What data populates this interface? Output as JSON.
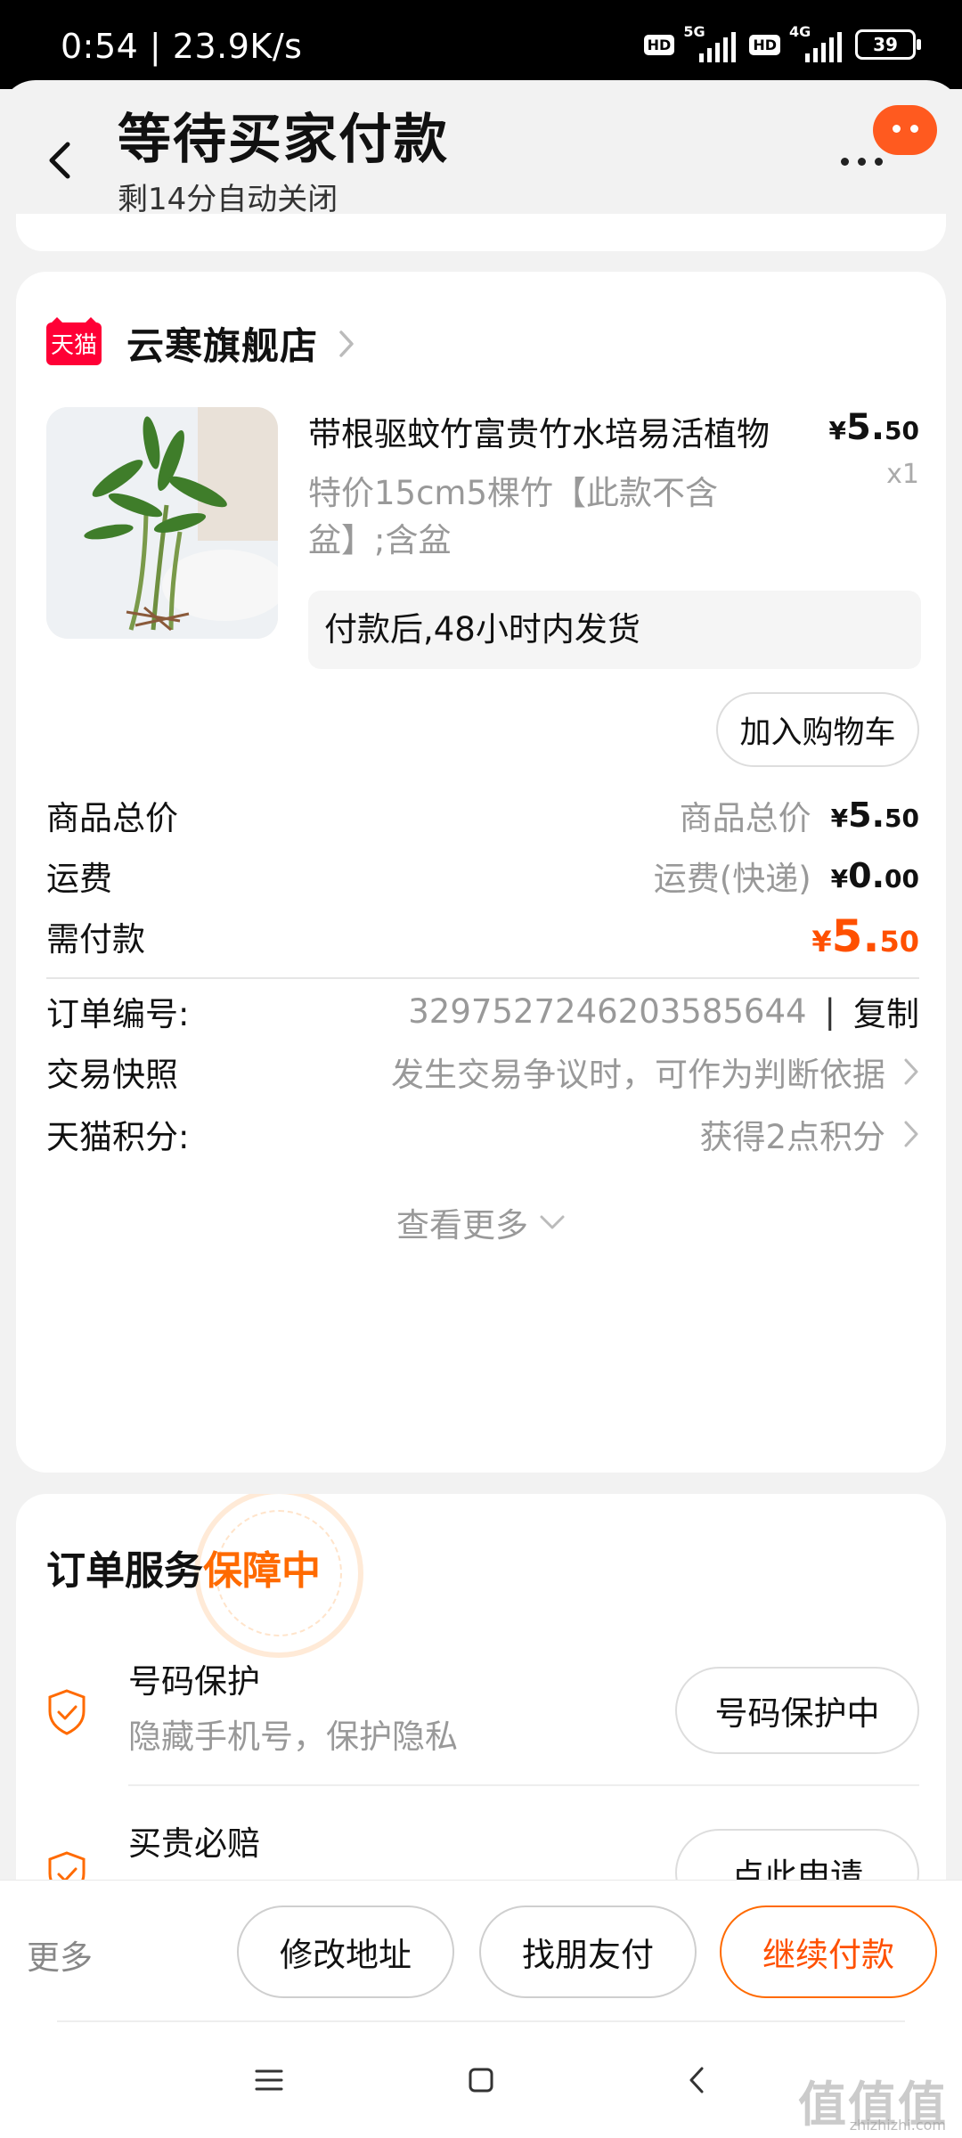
{
  "status_bar": {
    "time": "0:54 | 23.9K/s",
    "hd": "HD",
    "net1": "5G",
    "net2": "4G",
    "battery": "39"
  },
  "header": {
    "title": "等待买家付款",
    "subtitle": "剩14分自动关闭"
  },
  "shop": {
    "logo_text": "天猫",
    "name": "云寒旗舰店"
  },
  "product": {
    "title": "带根驱蚊竹富贵竹水培易活植物",
    "price_symbol": "¥",
    "price_int": "5.",
    "price_dec": "50",
    "qty": "x1",
    "sku": "特价15cm5棵竹【此款不含盆】;含盆",
    "ship_note": "付款后,48小时内发货",
    "cart_button": "加入购物车"
  },
  "summary": {
    "goods_total_label": "商品总价",
    "goods_total_hint": "商品总价",
    "goods_total_int": "5.",
    "goods_total_dec": "50",
    "shipping_label": "运费",
    "shipping_hint": "运费(快递)",
    "shipping_int": "0.",
    "shipping_dec": "00",
    "payable_label": "需付款",
    "payable_int": "5.",
    "payable_dec": "50",
    "currency": "¥"
  },
  "details": {
    "order_no_label": "订单编号:",
    "order_no": "3297527246203585644",
    "sep": "|",
    "copy": "复制",
    "snapshot_label": "交易快照",
    "snapshot_hint": "发生交易争议时，可作为判断依据",
    "points_label": "天猫积分:",
    "points_hint": "获得2点积分",
    "see_more": "查看更多"
  },
  "service": {
    "title": "订单服务",
    "title_highlight": "保障中",
    "items": [
      {
        "name": "号码保护",
        "desc": "隐藏手机号，保护隐私",
        "button": "号码保护中"
      },
      {
        "name": "买贵必赔",
        "desc": "",
        "button": "点此申请"
      }
    ]
  },
  "actions": {
    "more": "更多",
    "edit_address": "修改地址",
    "friend_pay": "找朋友付",
    "continue_pay": "继续付款"
  },
  "watermark": {
    "main": "值值值",
    "sub": "zhizhizhi.com"
  },
  "colors": {
    "accent": "#ff5000",
    "tmall_red": "#ff0036",
    "brand_orange": "#ff6a00"
  }
}
